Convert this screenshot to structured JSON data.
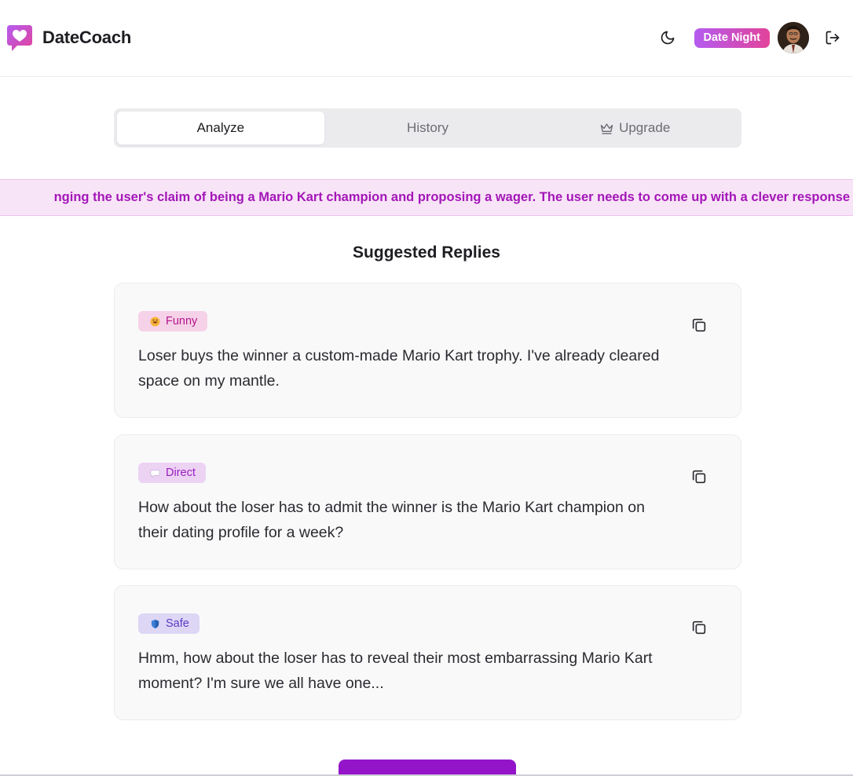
{
  "header": {
    "app_name": "DateCoach",
    "plan_badge": "Date Night",
    "icons": {
      "logo": "heart-chat-logo",
      "theme": "moon-icon",
      "avatar": "user-avatar",
      "logout": "logout-icon"
    }
  },
  "tabs": [
    {
      "label": "Analyze",
      "active": true
    },
    {
      "label": "History",
      "active": false
    },
    {
      "label": "Upgrade",
      "active": false,
      "icon": "crown-icon"
    }
  ],
  "banner": {
    "text": "nging the user's claim of being a Mario Kart champion and proposing a wager. The user needs to come up with a clever response"
  },
  "suggestions": {
    "title": "Suggested Replies",
    "items": [
      {
        "tag": "Funny",
        "tag_icon": "grinning-face-emoji",
        "text": "Loser buys the winner a custom-made Mario Kart trophy. I've already cleared space on my mantle."
      },
      {
        "tag": "Direct",
        "tag_icon": "speech-bubble-emoji",
        "text": "How about the loser has to admit the winner is the Mario Kart champion on their dating profile for a week?"
      },
      {
        "tag": "Safe",
        "tag_icon": "shield-emoji",
        "text": "Hmm, how about the loser has to reveal their most embarrassing Mario Kart moment? I'm sure we all have one..."
      }
    ]
  },
  "colors": {
    "accent": "#9415c9",
    "banner_bg": "#f8e4f7",
    "banner_text": "#a316b8",
    "badge_gradient_start": "#b45cf0",
    "badge_gradient_end": "#e2439a"
  }
}
